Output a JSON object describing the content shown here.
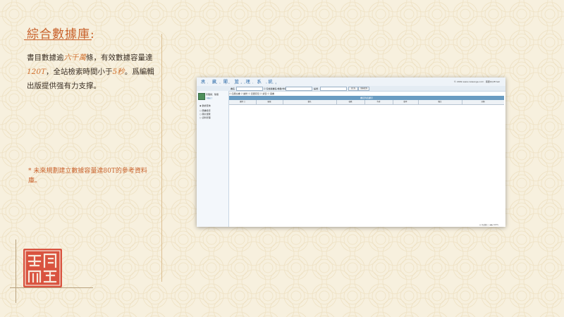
{
  "left": {
    "title": "綜合數據庫:",
    "para_1": "書目數據逾",
    "para_hl_1": "六千萬",
    "para_2": "條，有效數據容量達",
    "para_hl_2": "120T",
    "para_3": "，全站檢索時間小于",
    "para_hl_3": "5秒",
    "para_4": "。爲編輯出版提供强有力支撑。",
    "note": "* 未來規劃建立數據容量達80T的參考資料庫。"
  },
  "shot": {
    "app_title": "承 藏 閣 管 理 系 統",
    "app_subtitle": "cai  wen  ge  guan  li  xi  tong",
    "header_right": "© 2009 www.caiwenge.com  ·  客服QQ/Email",
    "toolbar": {
      "field_label": "書名",
      "check_label": "☑ 包含副書名/卷數/作者",
      "field2_label": "編號",
      "search_btn": "查 詢",
      "advanced_btn": "全庫查詢"
    },
    "filter_row": "☑ 四庫全書 ☑ 續修 ☑ 四庫存目 ☑ 禁毁 ☑ 叢書",
    "user": {
      "name": "管理員：陳偉",
      "link": "[ 退出 ]"
    },
    "sidebar": [
      {
        "label": "◉ 數據查詢"
      },
      {
        "label": "○ 圖書檢索"
      },
      {
        "label": "○ 圖片瀏覽"
      },
      {
        "label": "○ 資料管理"
      }
    ],
    "grid_title": "書目列表顯示",
    "columns": [
      "選擇 □",
      "編號",
      "書名",
      "卷數",
      "作者",
      "版本",
      "備注",
      "分類"
    ],
    "status": "◎ 已就緒  ▢ ◀ ▶ 100%"
  },
  "colors": {
    "accent": "#c8612a",
    "seal": "#d9533f",
    "divider": "#dcbf93"
  }
}
